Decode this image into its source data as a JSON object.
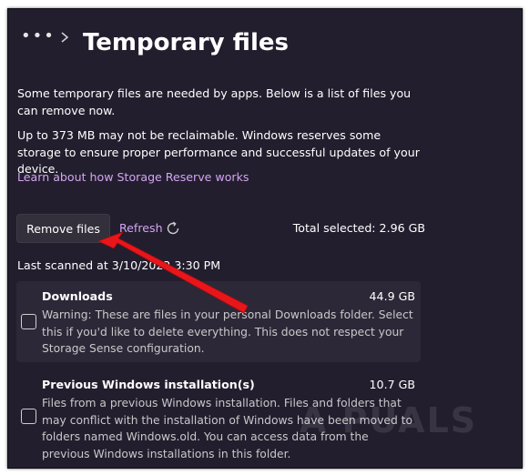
{
  "header": {
    "more_label": "•••",
    "title": "Temporary files"
  },
  "intro": {
    "p1": "Some temporary files are needed by apps. Below is a list of files you can remove now.",
    "p2": "Up to 373 MB may not be reclaimable. Windows reserves some storage to ensure proper performance and successful updates of your device.",
    "link": "Learn about how Storage Reserve works"
  },
  "actions": {
    "remove_label": "Remove files",
    "refresh_label": "Refresh",
    "total_selected": "Total selected: 2.96 GB"
  },
  "last_scanned": "Last scanned at 3/10/2022 3:30 PM",
  "items": [
    {
      "title": "Downloads",
      "size": "44.9 GB",
      "desc": "Warning: These are files in your personal Downloads folder. Select this if you'd like to delete everything. This does not respect your Storage Sense configuration."
    },
    {
      "title": "Previous Windows installation(s)",
      "size": "10.7 GB",
      "desc": "Files from a previous Windows installation.  Files and folders that may conflict with the installation of Windows have been moved to folders named Windows.old.  You can access data from the previous Windows installations in this folder."
    }
  ],
  "watermark": "A  PUALS",
  "colors": {
    "background": "#231e2e",
    "accent_link": "#d2a6f2",
    "arrow": "#e8161b"
  },
  "icons": [
    "more-icon",
    "chevron-right-icon",
    "refresh-icon",
    "annotation-arrow"
  ]
}
